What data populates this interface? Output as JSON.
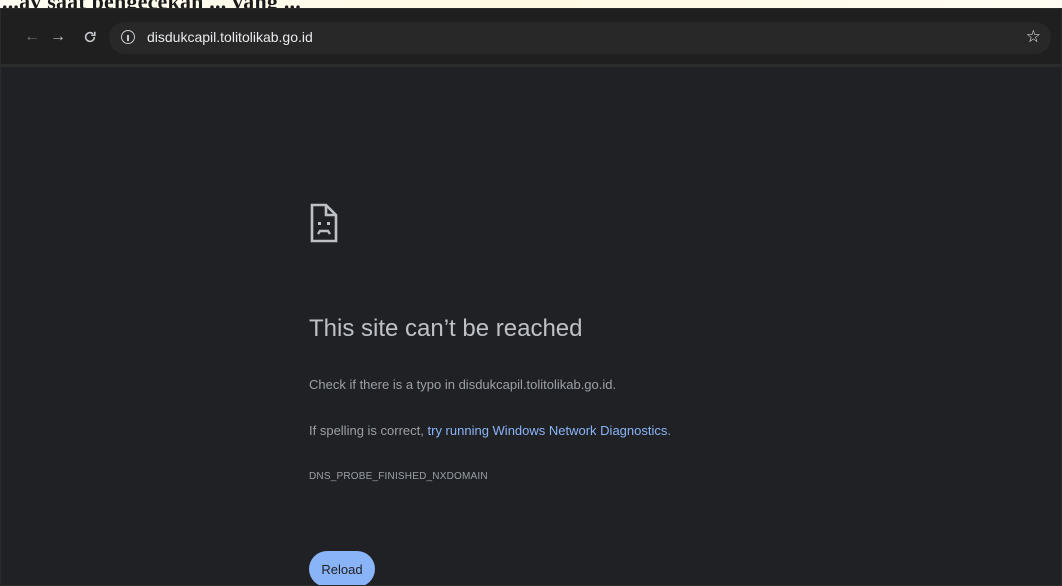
{
  "document": {
    "heading_fragment": "...ay saat pengecekan ... yang ..."
  },
  "browser": {
    "address_bar": {
      "url": "disdukcapil.tolitolikab.go.id"
    },
    "icons": {
      "back": "arrow-left-icon",
      "forward": "arrow-right-icon",
      "reload": "reload-icon",
      "site_info": "info-icon",
      "bookmark": "star-icon"
    }
  },
  "error_page": {
    "icon": "sad-document-icon",
    "title": "This site can’t be reached",
    "typo_message": "Check if there is a typo in disdukcapil.tolitolikab.go.id.",
    "spelling_prefix": "If spelling is correct, ",
    "diagnostics_link": "try running Windows Network Diagnostics",
    "spelling_suffix": ".",
    "error_code": "DNS_PROBE_FINISHED_NXDOMAIN",
    "reload_label": "Reload"
  },
  "colors": {
    "page_background": "#202124",
    "toolbar": "#1f1f1f",
    "link": "#8ab4f8",
    "button": "#8ab4f8"
  }
}
